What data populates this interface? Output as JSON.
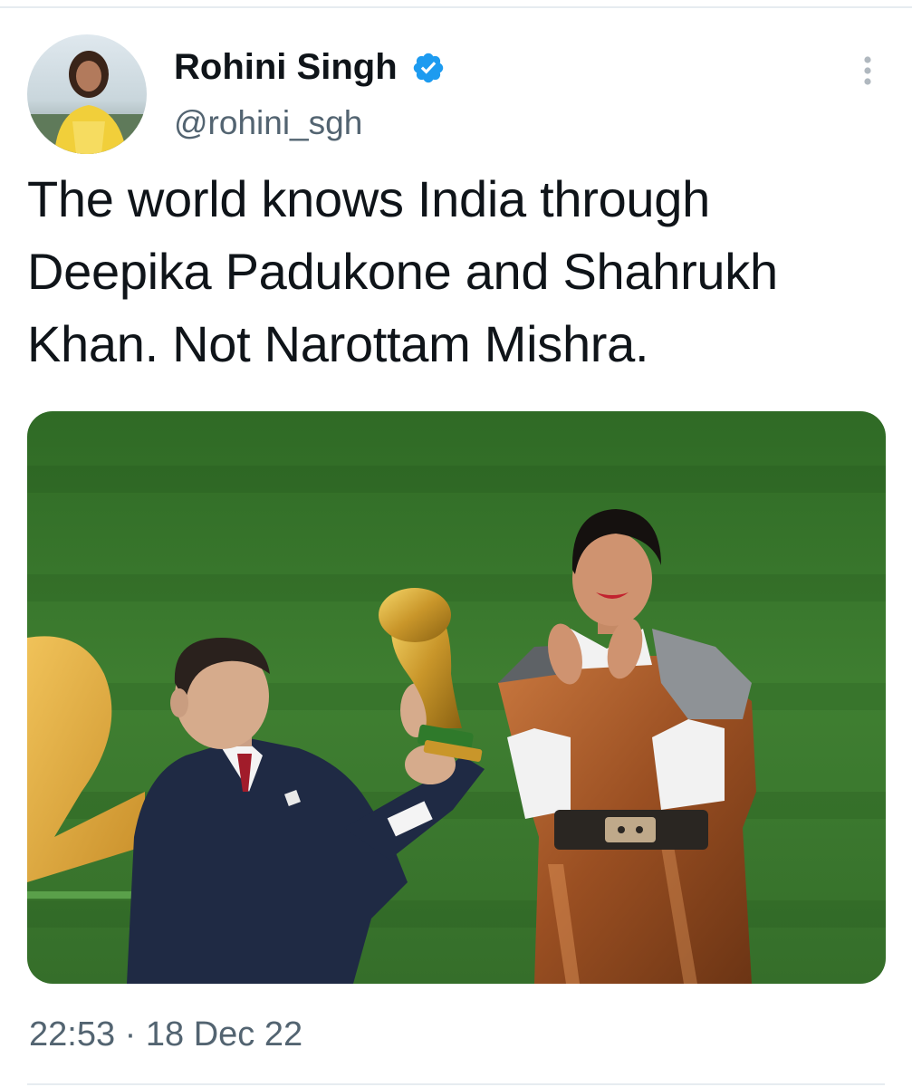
{
  "tweet": {
    "display_name": "Rohini Singh",
    "handle": "@rohini_sgh",
    "verified": true,
    "text": "The world knows India through Deepika Padukone and Shahrukh Khan. Not Narottam Mishra.",
    "time": "22:53",
    "separator": "·",
    "date": "18 Dec 22"
  },
  "icons": {
    "verified": "verified-badge-icon",
    "more": "more-vertical-icon"
  },
  "colors": {
    "verified_blue": "#1d9bf0",
    "secondary_text": "#536471",
    "primary_text": "#0f1419",
    "pitch_green": "#3f7f31"
  }
}
